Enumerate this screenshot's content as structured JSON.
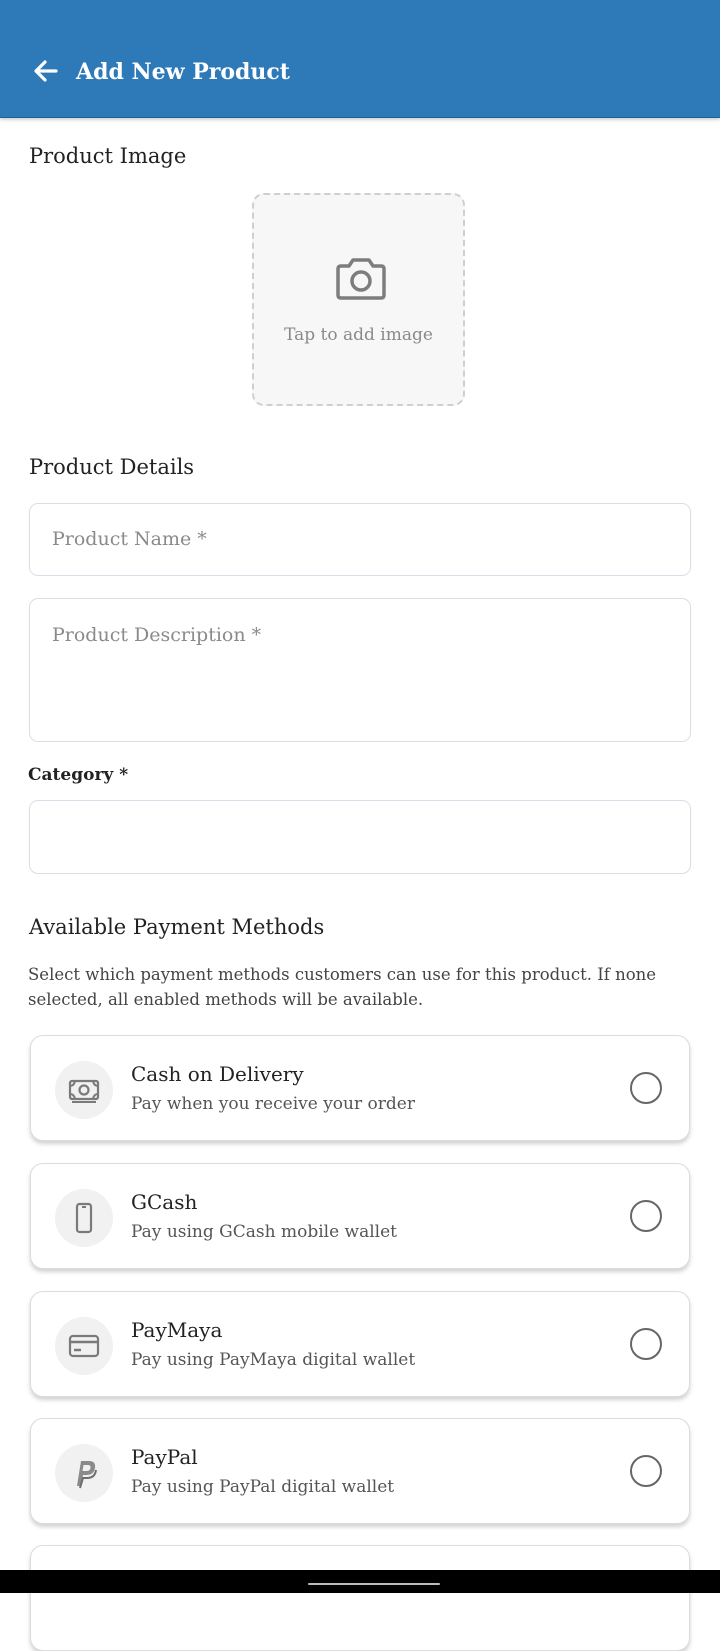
{
  "appbar": {
    "title": "Add New Product",
    "color": "#2e79b8"
  },
  "image_section": {
    "title": "Product Image",
    "tap_text": "Tap to add image"
  },
  "details_section": {
    "title": "Product Details",
    "name_placeholder": "Product Name *",
    "description_placeholder": "Product Description *",
    "category_label": "Category *",
    "category_value": ""
  },
  "payment_section": {
    "title": "Available Payment Methods",
    "description": "Select which payment methods customers can use for this product. If none selected, all enabled methods will be available.",
    "methods": [
      {
        "name": "Cash on Delivery",
        "sub": "Pay when you receive your order",
        "icon": "cash-icon",
        "selected": false
      },
      {
        "name": "GCash",
        "sub": "Pay using GCash mobile wallet",
        "icon": "phone-icon",
        "selected": false
      },
      {
        "name": "PayMaya",
        "sub": "Pay using PayMaya digital wallet",
        "icon": "card-icon",
        "selected": false
      },
      {
        "name": "PayPal",
        "sub": "Pay using PayPal digital wallet",
        "icon": "paypal-icon",
        "selected": false
      }
    ]
  }
}
